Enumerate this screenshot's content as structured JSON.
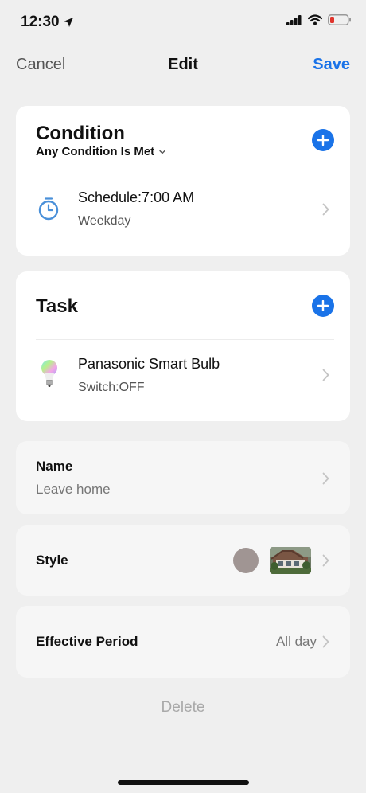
{
  "status_bar": {
    "time": "12:30"
  },
  "nav": {
    "cancel_label": "Cancel",
    "title": "Edit",
    "save_label": "Save"
  },
  "condition": {
    "title": "Condition",
    "mode": "Any Condition Is Met",
    "item": {
      "title": "Schedule:7:00 AM",
      "subtitle": "Weekday",
      "icon": "timer-icon"
    }
  },
  "task": {
    "title": "Task",
    "item": {
      "title": "Panasonic Smart Bulb",
      "subtitle": "Switch:OFF",
      "icon": "smart-bulb-icon"
    }
  },
  "name": {
    "label": "Name",
    "value": "Leave home"
  },
  "style": {
    "label": "Style",
    "color": "#a09593"
  },
  "effective_period": {
    "label": "Effective Period",
    "value": "All day"
  },
  "delete_label": "Delete",
  "colors": {
    "accent": "#1a73e8",
    "background": "#efefef",
    "card": "#ffffff"
  }
}
